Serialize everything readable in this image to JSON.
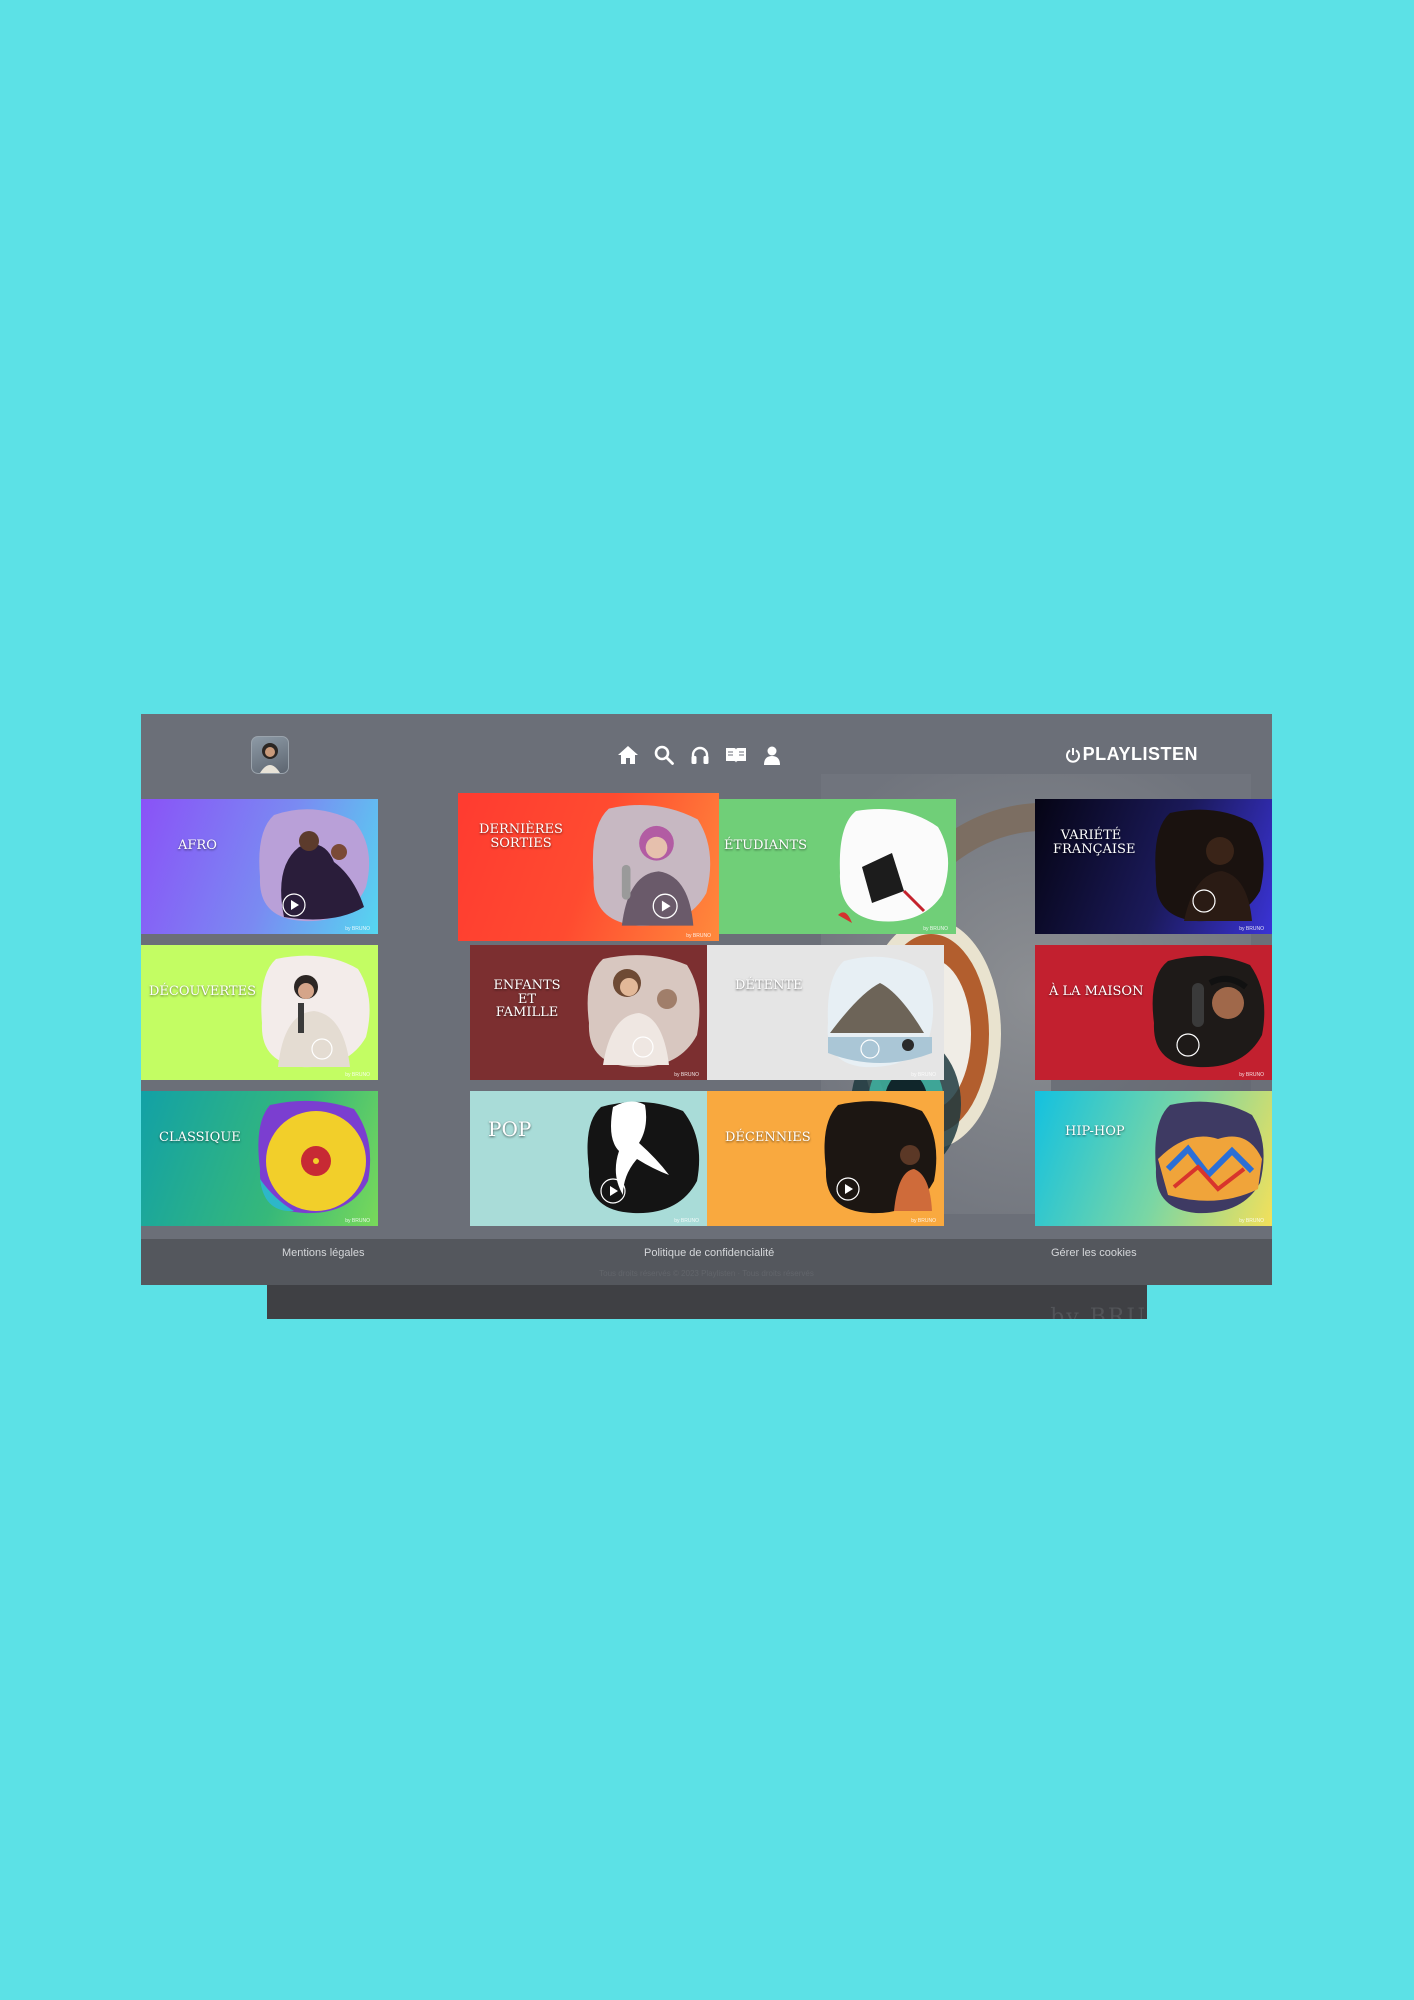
{
  "header": {
    "logo_text": "PLAYLISTEN",
    "avatar_icon": "user-avatar",
    "nav": [
      {
        "name": "home",
        "icon": "home-icon"
      },
      {
        "name": "search",
        "icon": "search-icon"
      },
      {
        "name": "listen",
        "icon": "headphones-icon"
      },
      {
        "name": "library",
        "icon": "book-icon"
      },
      {
        "name": "profile",
        "icon": "user-icon"
      }
    ]
  },
  "tiles": [
    {
      "label": "AFRO",
      "by": "by BRUNO"
    },
    {
      "label": "DÉCOUVERTES",
      "by": "by BRUNO"
    },
    {
      "label": "CLASSIQUE",
      "by": "by BRUNO"
    },
    {
      "label": "DERNIÈRES SORTIES",
      "by": "by BRUNO"
    },
    {
      "label": "ÉTUDIANTS",
      "by": "by BRUNO"
    },
    {
      "label": "ENFANTS ET FAMILLE",
      "by": "by BRUNO"
    },
    {
      "label": "DÉTENTE",
      "by": "by BRUNO"
    },
    {
      "label": "POP",
      "by": "by BRUNO"
    },
    {
      "label": "DÉCENNIES",
      "by": "by BRUNO"
    },
    {
      "label": "VARIÉTÉ FRANÇAISE",
      "by": "by BRUNO"
    },
    {
      "label": "À LA MAISON",
      "by": "by BRUNO"
    },
    {
      "label": "HIP-HOP",
      "by": "by BRUNO"
    }
  ],
  "footer": {
    "legal": "Mentions légales",
    "privacy": "Politique de confidencialité",
    "cookies": "Gérer les cookies",
    "copyright": "Tous droits réservés © 2023 Playlisten · Tous droits réservés"
  },
  "under_panel": {
    "watermark": "by BRU"
  },
  "colors": {
    "page_bg": "#5ce1e6",
    "app_bg": "#6b6f78",
    "footer_bg": "#54575d"
  }
}
